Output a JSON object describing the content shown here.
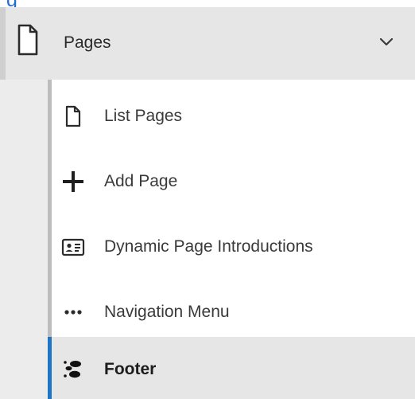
{
  "top_partial_text": "g",
  "section": {
    "title": "Pages",
    "icon": "page-icon",
    "chevron_icon": "chevron-down-icon",
    "expanded": true
  },
  "menu_items": [
    {
      "label": "List Pages",
      "icon": "page-icon",
      "active": false
    },
    {
      "label": "Add Page",
      "icon": "plus-icon",
      "active": false
    },
    {
      "label": "Dynamic Page Introductions",
      "icon": "id-card-icon",
      "active": false
    },
    {
      "label": "Navigation Menu",
      "icon": "more-horizontal-icon",
      "active": false
    },
    {
      "label": "Footer",
      "icon": "footprints-icon",
      "active": true
    }
  ],
  "colors": {
    "accent": "#1f74c6",
    "header_bg": "#e6e6e6",
    "text": "#3a3a3a"
  }
}
